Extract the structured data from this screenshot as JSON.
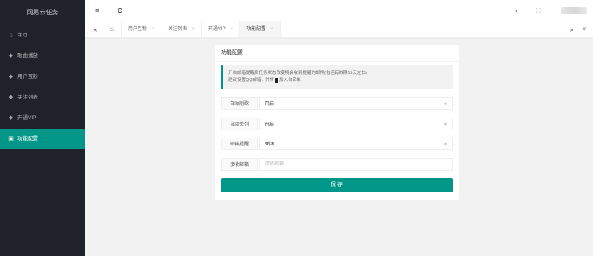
{
  "sidebar": {
    "logo": "网易云任务",
    "items": [
      {
        "icon": "home-icon",
        "glyph": "⌂",
        "label": "主页"
      },
      {
        "icon": "diamond-icon",
        "glyph": "◆",
        "label": "歌曲播放"
      },
      {
        "icon": "diamond-icon",
        "glyph": "◆",
        "label": "用户互粉"
      },
      {
        "icon": "diamond-icon",
        "glyph": "◆",
        "label": "关注列表"
      },
      {
        "icon": "diamond-icon",
        "glyph": "◆",
        "label": "开通VIP"
      },
      {
        "icon": "settings-grid-icon",
        "glyph": "▣",
        "label": "功能配置"
      }
    ],
    "active_index": 5
  },
  "header": {
    "menu_glyph": "≡",
    "refresh_glyph": "C",
    "theme_glyph": "◐",
    "fullscreen_glyph": "⛶"
  },
  "tabs": {
    "prev_glyph": "«",
    "next_glyph": "»",
    "more_glyph": "∨",
    "home_glyph": "⌂",
    "close_glyph": "×",
    "items": [
      {
        "label": "用户互粉"
      },
      {
        "label": "关注列表"
      },
      {
        "label": "开通VIP"
      },
      {
        "label": "功能配置"
      }
    ]
  },
  "card": {
    "title": "功能配置",
    "notice_line1": "开启邮箱提醒后任务状态改变将会收到提醒的邮件(包括有效期15天左右)",
    "notice_line2_a": "建议设置QQ邮箱，并将",
    "notice_line2_b": "加入白名单",
    "fields": [
      {
        "label": "自动刷歌",
        "value": "开启"
      },
      {
        "label": "自动关列",
        "value": "开启"
      },
      {
        "label": "邮箱提醒",
        "value": "关闭"
      }
    ],
    "email_label": "接收邮箱",
    "email_placeholder": "请填邮箱",
    "email_value": "",
    "save_label": "保存"
  },
  "colors": {
    "accent": "#009688",
    "sidebar_bg": "#20222a"
  }
}
